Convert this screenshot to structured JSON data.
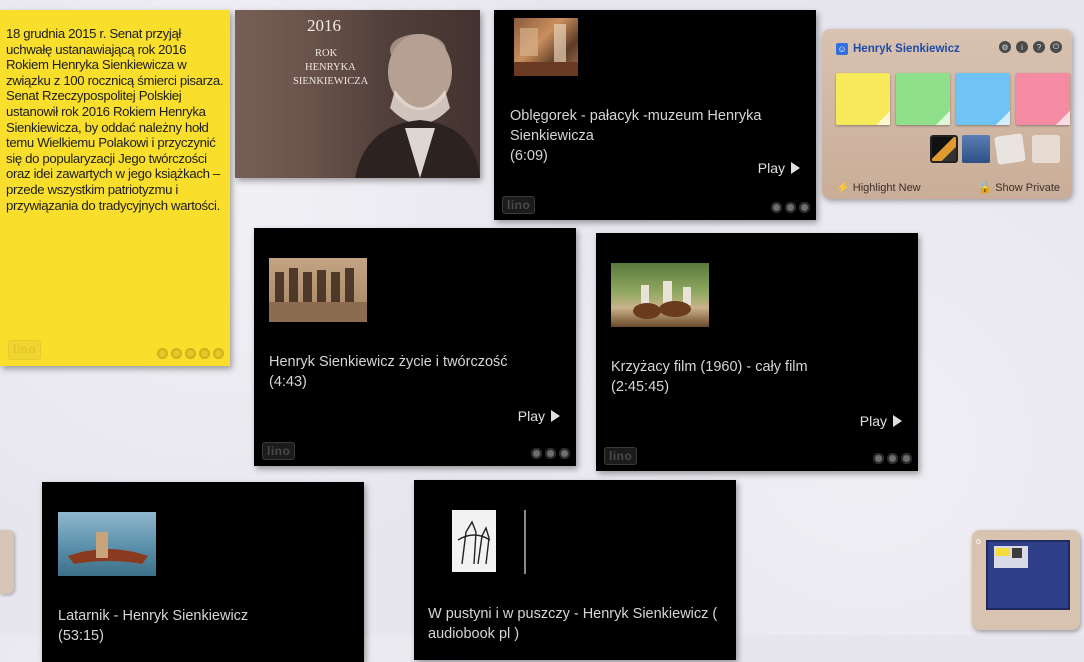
{
  "yellow_note": {
    "text": "18 grudnia 2015 r. Senat przyjął uchwałę ustanawiającą rok 2016 Rokiem Henryka Sienkiewicza w związku z 100 rocznicą śmierci pisarza. Senat Rzeczypospolitej Polskiej ustanowił rok 2016 Rokiem Henryka Sienkiewicza, by oddać należny hołd temu Wielkiemu Polakowi i przyczynić się do popularyzacji Jego twórczości oraz idei zawartych w jego książkach – przede wszystkim patriotyzmu i przywiązania do tradycyjnych wartości."
  },
  "poster": {
    "year": "2016",
    "line1": "ROK",
    "line2": "HENRYKA",
    "line3": "SIENKIEWICZA"
  },
  "videos": [
    {
      "title": "Oblęgorek - pałacyk -muzeum Henryka Sienkiewicza",
      "duration": "(6:09)",
      "play": "Play"
    },
    {
      "title": "Henryk Sienkiewicz życie i twórczość",
      "duration": "(4:43)",
      "play": "Play"
    },
    {
      "title": "Krzyżacy film (1960) - cały film",
      "duration": "(2:45:45)",
      "play": "Play"
    },
    {
      "title": "Latarnik - Henryk Sienkiewicz",
      "duration": "(53:15)",
      "play": ""
    },
    {
      "title": "W pustyni i w puszczy - Henryk Sienkiewicz (",
      "duration": "audiobook pl )",
      "play": ""
    }
  ],
  "lino_logo": "lino",
  "widget": {
    "user_name": "Henryk Sienkiewicz",
    "highlight_new": "Highlight New",
    "show_private": "Show Private",
    "pad_colors": [
      "#f7e95a",
      "#8fe08a",
      "#6fc4f5",
      "#f58aa3"
    ]
  }
}
